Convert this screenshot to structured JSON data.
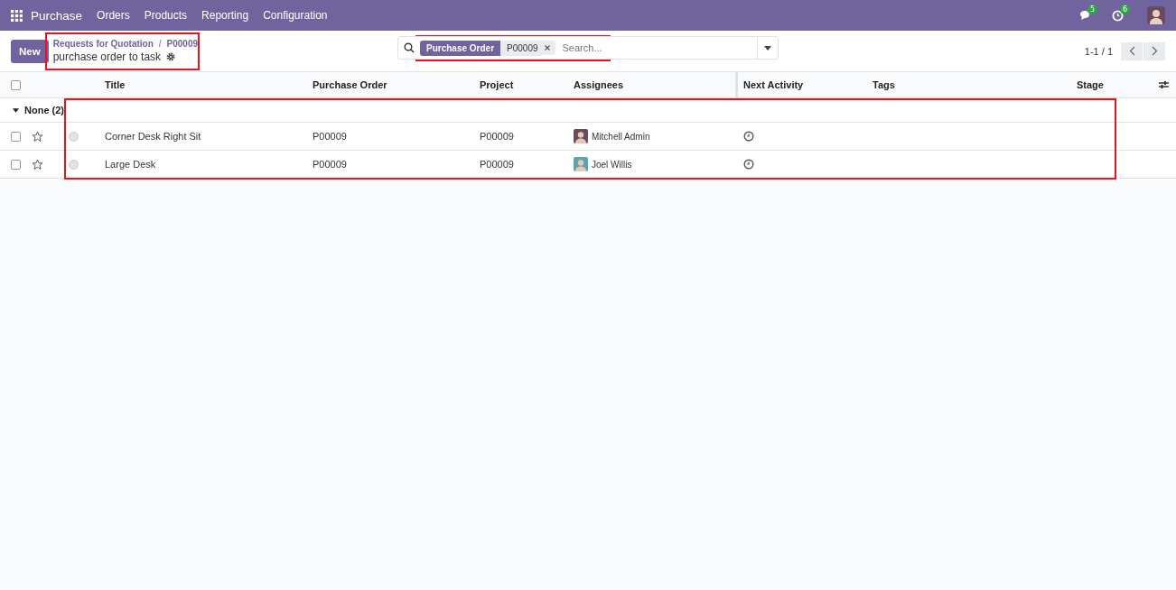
{
  "navbar": {
    "app": "Purchase",
    "menu": [
      "Orders",
      "Products",
      "Reporting",
      "Configuration"
    ],
    "messages_count": "5",
    "activities_count": "6"
  },
  "control_panel": {
    "new_button": "New",
    "breadcrumb": [
      "Requests for Quotation",
      "P00009"
    ],
    "breadcrumb_separator": "/",
    "breadcrumb_highlighted": true,
    "title": "purchase order to task",
    "search": {
      "facet_label": "Purchase Order",
      "facet_value": "P00009",
      "placeholder": "Search...",
      "highlighted": true
    },
    "pager": "1-1 / 1"
  },
  "table": {
    "select_all_checked": false,
    "rows_highlighted": true,
    "columns": [
      "Title",
      "Purchase Order",
      "Project",
      "Assignees",
      "Next Activity",
      "Tags",
      "Stage"
    ],
    "group": {
      "label": "None (2)",
      "expanded": true
    },
    "rows": [
      {
        "checked": false,
        "starred": false,
        "title": "Corner Desk Right Sit",
        "purchase_order": "P00009",
        "project": "P00009",
        "assignee": "Mitchell Admin"
      },
      {
        "checked": false,
        "starred": false,
        "title": "Large Desk",
        "purchase_order": "P00009",
        "project": "P00009",
        "assignee": "Joel Willis"
      }
    ]
  }
}
